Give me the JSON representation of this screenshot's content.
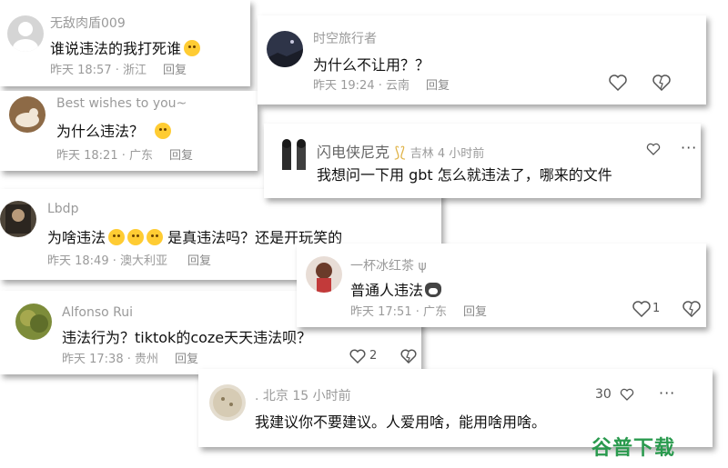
{
  "comments": [
    {
      "name": "无敌肉盾009",
      "text": "谁说违法的我打死谁",
      "time": "昨天 18:57 · 浙江",
      "reply": "回复"
    },
    {
      "name": "时空旅行者",
      "text": "为什么不让用？？",
      "time": "昨天 19:24 · 云南",
      "reply": "回复"
    },
    {
      "name": "Best wishes to you~",
      "text": "为什么违法？",
      "time": "昨天 18:21 · 广东",
      "reply": "回复"
    },
    {
      "name": "闪电侠尼克",
      "badge": "吉林 4 小时前",
      "text": "我想问一下用 gbt 怎么就违法了，哪来的文件"
    },
    {
      "name": "Lbdp",
      "text": "为啥违法",
      "text2": "是真违法吗？还是开玩笑的",
      "time": "昨天 18:49 · 澳大利亚",
      "reply": "回复"
    },
    {
      "name": "一杯冰红茶",
      "text": "普通人违法",
      "time": "昨天 17:51 · 广东",
      "reply": "回复",
      "likes": "1"
    },
    {
      "name": "Alfonso Rui",
      "text": "违法行为？tiktok的coze天天违法呗？",
      "time": "昨天 17:38 · 贵州",
      "reply": "回复",
      "likes": "2"
    },
    {
      "name": ". 北京 15 小时前",
      "text": "我建议你不要建议。人爱用啥，能用啥用啥。",
      "likes": "30"
    }
  ],
  "watermark": "谷普下载",
  "colors": {
    "card": "#ffffff",
    "muted": "#9a9a9a",
    "text": "#111111",
    "watermark": "#2a9a4e"
  }
}
